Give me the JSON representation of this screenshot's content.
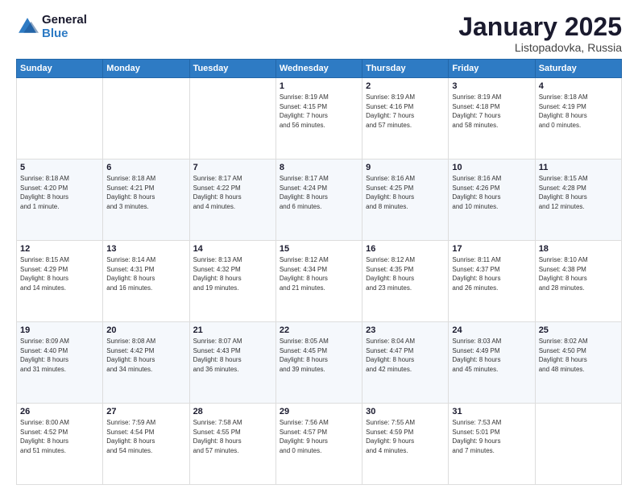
{
  "logo": {
    "line1": "General",
    "line2": "Blue"
  },
  "title": "January 2025",
  "subtitle": "Listopadovka, Russia",
  "days_header": [
    "Sunday",
    "Monday",
    "Tuesday",
    "Wednesday",
    "Thursday",
    "Friday",
    "Saturday"
  ],
  "weeks": [
    [
      {
        "num": "",
        "info": ""
      },
      {
        "num": "",
        "info": ""
      },
      {
        "num": "",
        "info": ""
      },
      {
        "num": "1",
        "info": "Sunrise: 8:19 AM\nSunset: 4:15 PM\nDaylight: 7 hours\nand 56 minutes."
      },
      {
        "num": "2",
        "info": "Sunrise: 8:19 AM\nSunset: 4:16 PM\nDaylight: 7 hours\nand 57 minutes."
      },
      {
        "num": "3",
        "info": "Sunrise: 8:19 AM\nSunset: 4:18 PM\nDaylight: 7 hours\nand 58 minutes."
      },
      {
        "num": "4",
        "info": "Sunrise: 8:18 AM\nSunset: 4:19 PM\nDaylight: 8 hours\nand 0 minutes."
      }
    ],
    [
      {
        "num": "5",
        "info": "Sunrise: 8:18 AM\nSunset: 4:20 PM\nDaylight: 8 hours\nand 1 minute."
      },
      {
        "num": "6",
        "info": "Sunrise: 8:18 AM\nSunset: 4:21 PM\nDaylight: 8 hours\nand 3 minutes."
      },
      {
        "num": "7",
        "info": "Sunrise: 8:17 AM\nSunset: 4:22 PM\nDaylight: 8 hours\nand 4 minutes."
      },
      {
        "num": "8",
        "info": "Sunrise: 8:17 AM\nSunset: 4:24 PM\nDaylight: 8 hours\nand 6 minutes."
      },
      {
        "num": "9",
        "info": "Sunrise: 8:16 AM\nSunset: 4:25 PM\nDaylight: 8 hours\nand 8 minutes."
      },
      {
        "num": "10",
        "info": "Sunrise: 8:16 AM\nSunset: 4:26 PM\nDaylight: 8 hours\nand 10 minutes."
      },
      {
        "num": "11",
        "info": "Sunrise: 8:15 AM\nSunset: 4:28 PM\nDaylight: 8 hours\nand 12 minutes."
      }
    ],
    [
      {
        "num": "12",
        "info": "Sunrise: 8:15 AM\nSunset: 4:29 PM\nDaylight: 8 hours\nand 14 minutes."
      },
      {
        "num": "13",
        "info": "Sunrise: 8:14 AM\nSunset: 4:31 PM\nDaylight: 8 hours\nand 16 minutes."
      },
      {
        "num": "14",
        "info": "Sunrise: 8:13 AM\nSunset: 4:32 PM\nDaylight: 8 hours\nand 19 minutes."
      },
      {
        "num": "15",
        "info": "Sunrise: 8:12 AM\nSunset: 4:34 PM\nDaylight: 8 hours\nand 21 minutes."
      },
      {
        "num": "16",
        "info": "Sunrise: 8:12 AM\nSunset: 4:35 PM\nDaylight: 8 hours\nand 23 minutes."
      },
      {
        "num": "17",
        "info": "Sunrise: 8:11 AM\nSunset: 4:37 PM\nDaylight: 8 hours\nand 26 minutes."
      },
      {
        "num": "18",
        "info": "Sunrise: 8:10 AM\nSunset: 4:38 PM\nDaylight: 8 hours\nand 28 minutes."
      }
    ],
    [
      {
        "num": "19",
        "info": "Sunrise: 8:09 AM\nSunset: 4:40 PM\nDaylight: 8 hours\nand 31 minutes."
      },
      {
        "num": "20",
        "info": "Sunrise: 8:08 AM\nSunset: 4:42 PM\nDaylight: 8 hours\nand 34 minutes."
      },
      {
        "num": "21",
        "info": "Sunrise: 8:07 AM\nSunset: 4:43 PM\nDaylight: 8 hours\nand 36 minutes."
      },
      {
        "num": "22",
        "info": "Sunrise: 8:05 AM\nSunset: 4:45 PM\nDaylight: 8 hours\nand 39 minutes."
      },
      {
        "num": "23",
        "info": "Sunrise: 8:04 AM\nSunset: 4:47 PM\nDaylight: 8 hours\nand 42 minutes."
      },
      {
        "num": "24",
        "info": "Sunrise: 8:03 AM\nSunset: 4:49 PM\nDaylight: 8 hours\nand 45 minutes."
      },
      {
        "num": "25",
        "info": "Sunrise: 8:02 AM\nSunset: 4:50 PM\nDaylight: 8 hours\nand 48 minutes."
      }
    ],
    [
      {
        "num": "26",
        "info": "Sunrise: 8:00 AM\nSunset: 4:52 PM\nDaylight: 8 hours\nand 51 minutes."
      },
      {
        "num": "27",
        "info": "Sunrise: 7:59 AM\nSunset: 4:54 PM\nDaylight: 8 hours\nand 54 minutes."
      },
      {
        "num": "28",
        "info": "Sunrise: 7:58 AM\nSunset: 4:55 PM\nDaylight: 8 hours\nand 57 minutes."
      },
      {
        "num": "29",
        "info": "Sunrise: 7:56 AM\nSunset: 4:57 PM\nDaylight: 9 hours\nand 0 minutes."
      },
      {
        "num": "30",
        "info": "Sunrise: 7:55 AM\nSunset: 4:59 PM\nDaylight: 9 hours\nand 4 minutes."
      },
      {
        "num": "31",
        "info": "Sunrise: 7:53 AM\nSunset: 5:01 PM\nDaylight: 9 hours\nand 7 minutes."
      },
      {
        "num": "",
        "info": ""
      }
    ]
  ]
}
